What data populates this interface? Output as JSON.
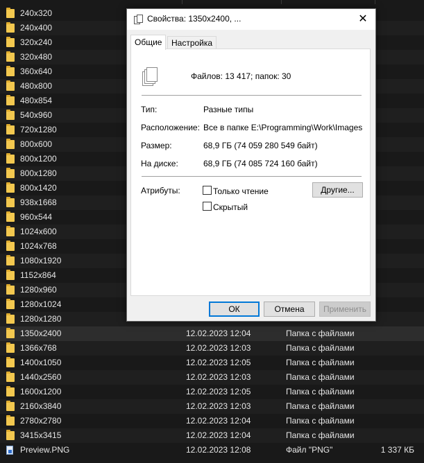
{
  "file_list": {
    "rows": [
      {
        "name": "240x320",
        "date": "",
        "type": "",
        "size": "",
        "kind": "folder"
      },
      {
        "name": "240x400",
        "date": "",
        "type": "",
        "size": "",
        "kind": "folder"
      },
      {
        "name": "320x240",
        "date": "",
        "type": "",
        "size": "",
        "kind": "folder"
      },
      {
        "name": "320x480",
        "date": "",
        "type": "",
        "size": "",
        "kind": "folder"
      },
      {
        "name": "360x640",
        "date": "",
        "type": "",
        "size": "",
        "kind": "folder"
      },
      {
        "name": "480x800",
        "date": "",
        "type": "",
        "size": "",
        "kind": "folder"
      },
      {
        "name": "480x854",
        "date": "",
        "type": "",
        "size": "",
        "kind": "folder"
      },
      {
        "name": "540x960",
        "date": "",
        "type": "",
        "size": "",
        "kind": "folder"
      },
      {
        "name": "720x1280",
        "date": "",
        "type": "",
        "size": "",
        "kind": "folder"
      },
      {
        "name": "800x600",
        "date": "",
        "type": "",
        "size": "",
        "kind": "folder"
      },
      {
        "name": "800x1200",
        "date": "",
        "type": "",
        "size": "",
        "kind": "folder"
      },
      {
        "name": "800x1280",
        "date": "",
        "type": "",
        "size": "",
        "kind": "folder"
      },
      {
        "name": "800x1420",
        "date": "",
        "type": "",
        "size": "",
        "kind": "folder"
      },
      {
        "name": "938x1668",
        "date": "",
        "type": "",
        "size": "",
        "kind": "folder"
      },
      {
        "name": "960x544",
        "date": "",
        "type": "",
        "size": "",
        "kind": "folder"
      },
      {
        "name": "1024x600",
        "date": "",
        "type": "",
        "size": "",
        "kind": "folder"
      },
      {
        "name": "1024x768",
        "date": "",
        "type": "",
        "size": "",
        "kind": "folder"
      },
      {
        "name": "1080x1920",
        "date": "",
        "type": "",
        "size": "",
        "kind": "folder"
      },
      {
        "name": "1152x864",
        "date": "",
        "type": "",
        "size": "",
        "kind": "folder"
      },
      {
        "name": "1280x960",
        "date": "",
        "type": "",
        "size": "",
        "kind": "folder"
      },
      {
        "name": "1280x1024",
        "date": "",
        "type": "",
        "size": "",
        "kind": "folder"
      },
      {
        "name": "1280x1280",
        "date": "",
        "type": "",
        "size": "",
        "kind": "folder"
      },
      {
        "name": "1350x2400",
        "date": "12.02.2023 12:04",
        "type": "Папка с файлами",
        "size": "",
        "kind": "folder"
      },
      {
        "name": "1366x768",
        "date": "12.02.2023 12:03",
        "type": "Папка с файлами",
        "size": "",
        "kind": "folder"
      },
      {
        "name": "1400x1050",
        "date": "12.02.2023 12:05",
        "type": "Папка с файлами",
        "size": "",
        "kind": "folder"
      },
      {
        "name": "1440x2560",
        "date": "12.02.2023 12:03",
        "type": "Папка с файлами",
        "size": "",
        "kind": "folder"
      },
      {
        "name": "1600x1200",
        "date": "12.02.2023 12:05",
        "type": "Папка с файлами",
        "size": "",
        "kind": "folder"
      },
      {
        "name": "2160x3840",
        "date": "12.02.2023 12:03",
        "type": "Папка с файлами",
        "size": "",
        "kind": "folder"
      },
      {
        "name": "2780x2780",
        "date": "12.02.2023 12:04",
        "type": "Папка с файлами",
        "size": "",
        "kind": "folder"
      },
      {
        "name": "3415x3415",
        "date": "12.02.2023 12:04",
        "type": "Папка с файлами",
        "size": "",
        "kind": "folder"
      },
      {
        "name": "Preview.PNG",
        "date": "12.02.2023 12:08",
        "type": "Файл \"PNG\"",
        "size": "1 337 КБ",
        "kind": "file"
      }
    ]
  },
  "dialog": {
    "title": "Свойства: 1350x2400, ...",
    "close_label": "✕",
    "tabs": [
      "Общие",
      "Настройка"
    ],
    "summary": "Файлов: 13 417; папок: 30",
    "type_label": "Тип:",
    "type_value": "Разные типы",
    "location_label": "Расположение:",
    "location_value": "Все в папке E:\\Programming\\Work\\Images",
    "size_label": "Размер:",
    "size_value": "68,9 ГБ (74 059 280 549 байт)",
    "ondisk_label": "На диске:",
    "ondisk_value": "68,9 ГБ (74 085 724 160 байт)",
    "attributes_label": "Атрибуты:",
    "readonly_label": "Только чтение",
    "hidden_label": "Скрытый",
    "other_button": "Другие...",
    "ok_button": "ОК",
    "cancel_button": "Отмена",
    "apply_button": "Применить"
  }
}
